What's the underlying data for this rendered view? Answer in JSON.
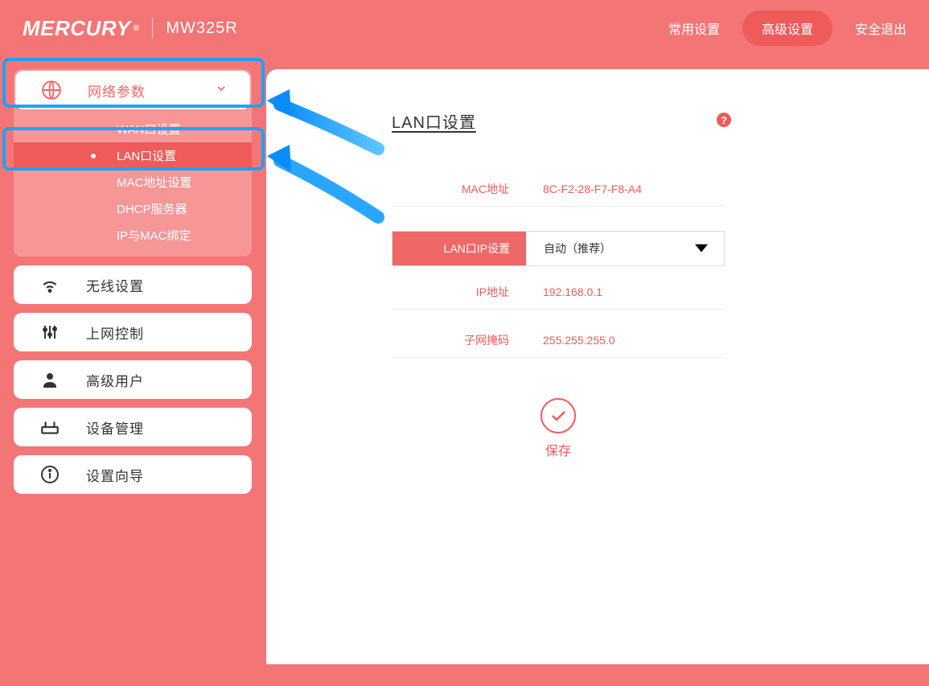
{
  "header": {
    "brand": "MERCURY",
    "model": "MW325R",
    "nav_common": "常用设置",
    "nav_advanced": "高级设置",
    "nav_logout": "安全退出"
  },
  "sidebar": {
    "network": {
      "label": "网络参数",
      "items": {
        "wan": "WAN口设置",
        "lan": "LAN口设置",
        "mac": "MAC地址设置",
        "dhcp": "DHCP服务器",
        "ipmac": "IP与MAC绑定"
      }
    },
    "wireless": "无线设置",
    "parental": "上网控制",
    "advuser": "高级用户",
    "device": "设备管理",
    "wizard": "设置向导"
  },
  "content": {
    "title": "LAN口设置",
    "fields": {
      "mac_label": "MAC地址",
      "mac_value": "8C-F2-28-F7-F8-A4",
      "lanip_label": "LAN口IP设置",
      "lanip_value": "自动（推荐）",
      "ip_label": "IP地址",
      "ip_value": "192.168.0.1",
      "mask_label": "子网掩码",
      "mask_value": "255.255.255.0"
    },
    "save": "保存"
  }
}
